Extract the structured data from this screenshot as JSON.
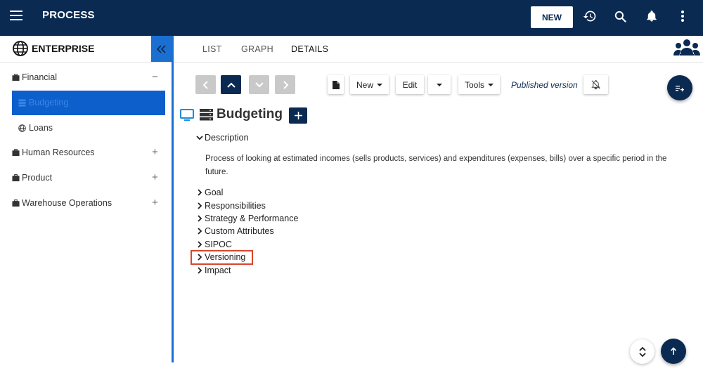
{
  "app": {
    "title": "PROCESS",
    "new_label": "NEW"
  },
  "topbar_icons": [
    "menu-icon",
    "history-icon",
    "search-icon",
    "bell-icon",
    "more-vertical-icon"
  ],
  "sidebar": {
    "title": "ENTERPRISE",
    "items": [
      {
        "label": "Financial",
        "toggle": "−"
      },
      {
        "label": "Budgeting"
      },
      {
        "label": "Loans"
      },
      {
        "label": "Human Resources",
        "toggle": "+"
      },
      {
        "label": "Product",
        "toggle": "+"
      },
      {
        "label": "Warehouse Operations",
        "toggle": "+"
      }
    ]
  },
  "tabs": [
    "LIST",
    "GRAPH",
    "DETAILS"
  ],
  "active_tab": "DETAILS",
  "toolbar": {
    "new_label": "New",
    "edit_label": "Edit",
    "tools_label": "Tools",
    "published_version": "Published version"
  },
  "content": {
    "title": "Budgeting",
    "description_label": "Description",
    "description_text": "Process of looking at estimated incomes (sells products, services) and expenditures (expenses, bills) over a specific period in the future.",
    "sections": [
      "Goal",
      "Responsibilities",
      "Strategy & Performance",
      "Custom Attributes",
      "SIPOC",
      "Versioning",
      "Impact"
    ],
    "highlighted_section": "Versioning"
  },
  "colors": {
    "navy": "#0a2a52",
    "accent_blue": "#1a6fd1",
    "selected_blue": "#0d5fcc",
    "highlight_red": "#d8462c"
  }
}
